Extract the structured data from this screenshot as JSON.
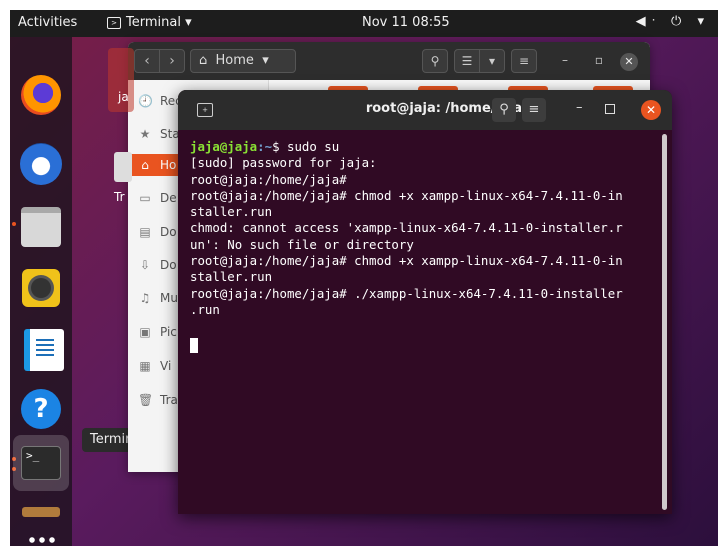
{
  "topbar": {
    "activities": "Activities",
    "app_name": "Terminal ▾",
    "clock": "Nov 11  08:55",
    "system_icons": "◀ᐧ ⏻ ▾"
  },
  "dock": {
    "tooltip": "Terminal",
    "term_icon_text": ">_"
  },
  "files": {
    "location": "Home",
    "sidebar": [
      {
        "icon": "🕘",
        "label": "Rece"
      },
      {
        "icon": "★",
        "label": "Sta"
      },
      {
        "icon": "⌂",
        "label": "Ho"
      },
      {
        "icon": "▭",
        "label": "De"
      },
      {
        "icon": "▤",
        "label": "Do"
      },
      {
        "icon": "⇩",
        "label": "Do"
      },
      {
        "icon": "♫",
        "label": "Mu"
      },
      {
        "icon": "▣",
        "label": "Pic"
      },
      {
        "icon": "▦",
        "label": "Vi"
      },
      {
        "icon": "🗑",
        "label": "Tra"
      }
    ],
    "desktop_label_1": "ja",
    "desktop_label_2": "Tr"
  },
  "terminal": {
    "title": "root@jaja: /home/jaja",
    "prompt_user": "jaja@jaja",
    "prompt_path": ":~",
    "first_cmd": "$ sudo su",
    "lines": [
      "[sudo] password for jaja:",
      "root@jaja:/home/jaja#",
      "root@jaja:/home/jaja# chmod +x xampp-linux-x64-7.4.11-0-in",
      "staller.run",
      "chmod: cannot access 'xampp-linux-x64-7.4.11-0-installer.r",
      "un': No such file or directory",
      "root@jaja:/home/jaja# chmod +x xampp-linux-x64-7.4.11-0-in",
      "staller.run",
      "root@jaja:/home/jaja# ./xampp-linux-x64-7.4.11-0-installer",
      ".run"
    ]
  }
}
